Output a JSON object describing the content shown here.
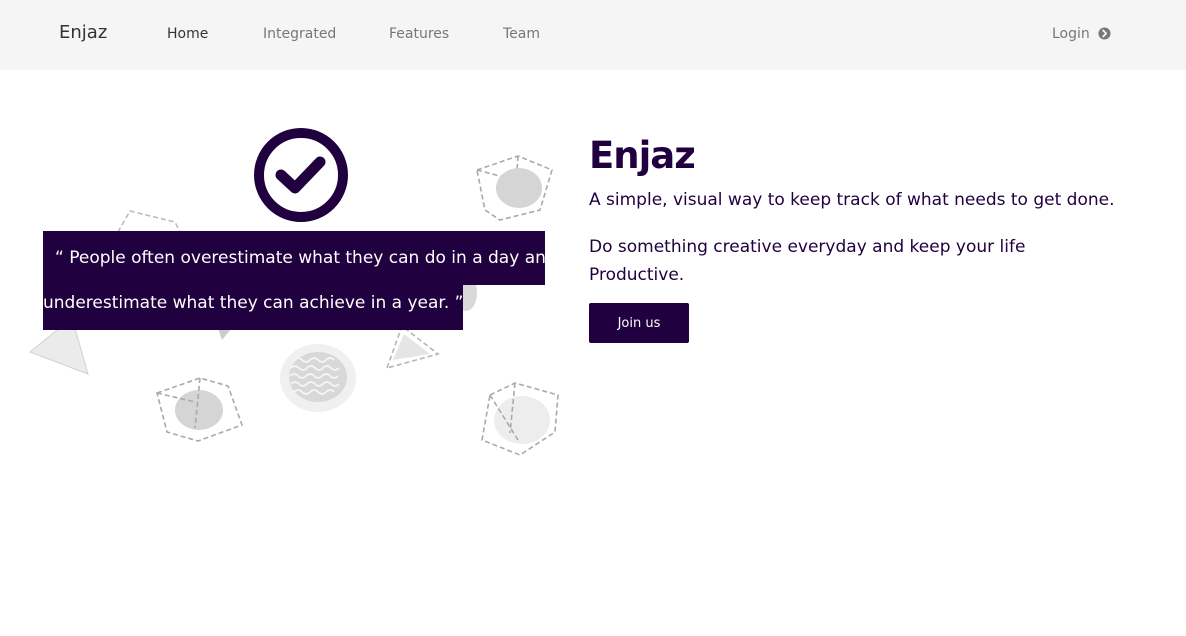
{
  "navbar": {
    "brand": "Enjaz",
    "links": [
      {
        "label": "Home",
        "active": true
      },
      {
        "label": "Integrated",
        "active": false
      },
      {
        "label": "Features",
        "active": false
      },
      {
        "label": "Team",
        "active": false
      }
    ],
    "login_label": "Login",
    "login_icon": "chevron-circle-right-icon"
  },
  "quote": {
    "line1": "“ People often overestimate what they can do in a day and",
    "line2": "underestimate what they can achieve in a year. ”"
  },
  "hero": {
    "title": "Enjaz",
    "tagline": "A simple, visual way to keep track of what needs to get done.",
    "text_line1": "Do something creative everyday and keep your life",
    "text_line2": "Productive.",
    "join_label": "Join us"
  },
  "colors": {
    "brand": "#21003f",
    "navbar_bg": "#f5f5f5"
  }
}
